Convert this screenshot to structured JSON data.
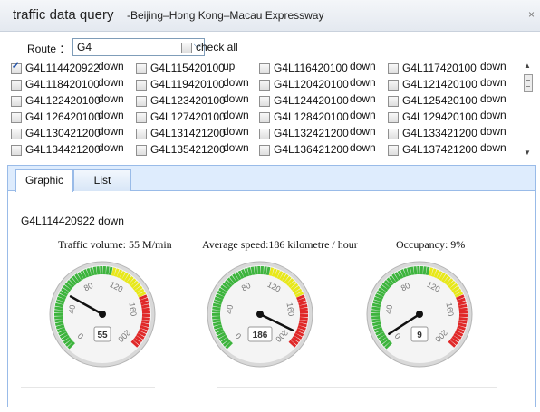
{
  "window": {
    "title": "traffic data query",
    "subtitle": "-Beijing–Hong Kong–Macau Expressway",
    "close_glyph": "×"
  },
  "route": {
    "label": "Route ：",
    "value": "G4",
    "check_all_label": "check all",
    "check_all_checked": false
  },
  "roads": [
    {
      "code": "G4L114420922",
      "status": "down",
      "checked": true
    },
    {
      "code": "G4L115420100",
      "status": "up",
      "checked": false
    },
    {
      "code": "G4L116420100",
      "status": "down",
      "checked": false
    },
    {
      "code": "G4L117420100",
      "status": "down",
      "checked": false
    },
    {
      "code": "G4L118420100",
      "status": "down",
      "checked": false
    },
    {
      "code": "G4L119420100",
      "status": "down",
      "checked": false
    },
    {
      "code": "G4L120420100",
      "status": "down",
      "checked": false
    },
    {
      "code": "G4L121420100",
      "status": "down",
      "checked": false
    },
    {
      "code": "G4L122420100",
      "status": "down",
      "checked": false
    },
    {
      "code": "G4L123420100",
      "status": "down",
      "checked": false
    },
    {
      "code": "G4L124420100",
      "status": "down",
      "checked": false
    },
    {
      "code": "G4L125420100",
      "status": "down",
      "checked": false
    },
    {
      "code": "G4L126420100",
      "status": "down",
      "checked": false
    },
    {
      "code": "G4L127420100",
      "status": "down",
      "checked": false
    },
    {
      "code": "G4L128420100",
      "status": "down",
      "checked": false
    },
    {
      "code": "G4L129420100",
      "status": "down",
      "checked": false
    },
    {
      "code": "G4L130421200",
      "status": "down",
      "checked": false
    },
    {
      "code": "G4L131421200",
      "status": "down",
      "checked": false
    },
    {
      "code": "G4L132421200",
      "status": "down",
      "checked": false
    },
    {
      "code": "G4L133421200",
      "status": "down",
      "checked": false
    },
    {
      "code": "G4L134421200",
      "status": "down",
      "checked": false
    },
    {
      "code": "G4L135421200",
      "status": "down",
      "checked": false
    },
    {
      "code": "G4L136421200",
      "status": "down",
      "checked": false
    },
    {
      "code": "G4L137421200",
      "status": "down",
      "checked": false
    }
  ],
  "tabs": [
    {
      "label": "Graphic",
      "active": true
    },
    {
      "label": "List",
      "active": false
    }
  ],
  "selected_road": "G4L114420922 down",
  "gauges": [
    {
      "label": "Traffic volume: 55 M/min",
      "value": 55,
      "display": "55"
    },
    {
      "label": "Average speed:186 kilometre / hour",
      "value": 186,
      "display": "186"
    },
    {
      "label": "Occupancy: 9%",
      "value": 9,
      "display": "9"
    }
  ],
  "gauge_scale": {
    "min": 0,
    "max": 200,
    "ticks": [
      "0",
      "40",
      "80",
      "120",
      "160",
      "200"
    ]
  },
  "colors": {
    "green": "#3db43d",
    "yellow": "#e8e81a",
    "red": "#e02828",
    "tab_bar": "#deecfd",
    "panel_border": "#99bbe8"
  }
}
